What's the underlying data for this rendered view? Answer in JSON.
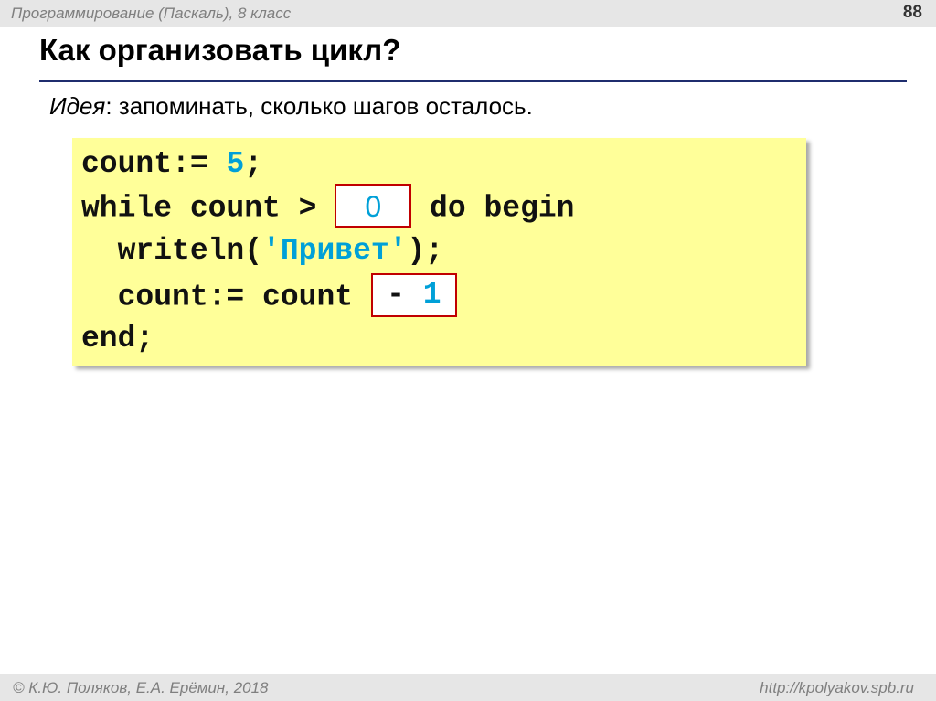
{
  "header": {
    "course": "Программирование (Паскаль), 8 класс",
    "page_number": "88"
  },
  "slide": {
    "title": "Как организовать цикл?",
    "idea_lead": "Идея",
    "idea_text": ": запоминать, сколько шагов осталось."
  },
  "code": {
    "line1_a": "count:= ",
    "line1_num": "5",
    "line1_b": ";",
    "line2_a": "while count > ",
    "line2_blank": "0",
    "line2_b": " do begin",
    "line3_a": "  writeln(",
    "line3_str": "'Привет'",
    "line3_b": ");",
    "line4_a": "  count:= count ",
    "line4_blank_op": "- ",
    "line4_blank_num": "1",
    "line5": "end;"
  },
  "footer": {
    "author": "© К.Ю. Поляков, Е.А. Ерёмин, 2018",
    "url": "http://kpolyakov.spb.ru"
  },
  "colors": {
    "code_background": "#ffff99",
    "blank_border": "#c00000",
    "literal": "#00a0d8",
    "title_rule": "#1f2d6e"
  }
}
